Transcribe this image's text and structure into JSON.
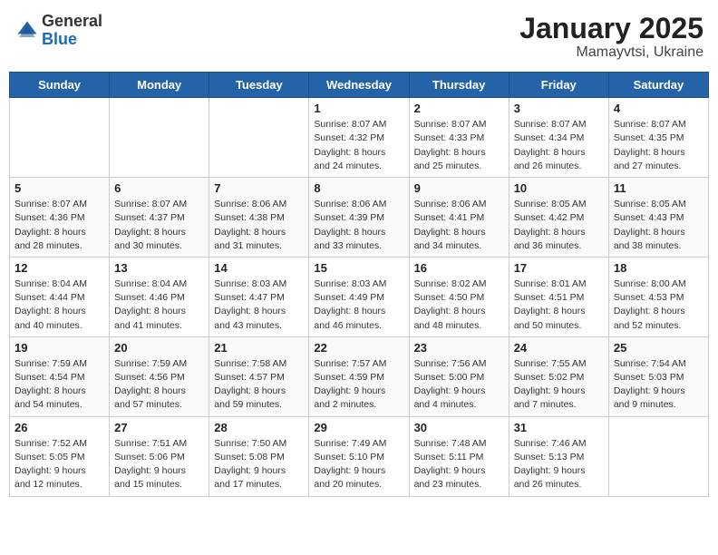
{
  "header": {
    "logo_general": "General",
    "logo_blue": "Blue",
    "title": "January 2025",
    "subtitle": "Mamayvtsi, Ukraine"
  },
  "weekdays": [
    "Sunday",
    "Monday",
    "Tuesday",
    "Wednesday",
    "Thursday",
    "Friday",
    "Saturday"
  ],
  "weeks": [
    [
      {
        "day": "",
        "sunrise": "",
        "sunset": "",
        "daylight": ""
      },
      {
        "day": "",
        "sunrise": "",
        "sunset": "",
        "daylight": ""
      },
      {
        "day": "",
        "sunrise": "",
        "sunset": "",
        "daylight": ""
      },
      {
        "day": "1",
        "sunrise": "Sunrise: 8:07 AM",
        "sunset": "Sunset: 4:32 PM",
        "daylight": "Daylight: 8 hours and 24 minutes."
      },
      {
        "day": "2",
        "sunrise": "Sunrise: 8:07 AM",
        "sunset": "Sunset: 4:33 PM",
        "daylight": "Daylight: 8 hours and 25 minutes."
      },
      {
        "day": "3",
        "sunrise": "Sunrise: 8:07 AM",
        "sunset": "Sunset: 4:34 PM",
        "daylight": "Daylight: 8 hours and 26 minutes."
      },
      {
        "day": "4",
        "sunrise": "Sunrise: 8:07 AM",
        "sunset": "Sunset: 4:35 PM",
        "daylight": "Daylight: 8 hours and 27 minutes."
      }
    ],
    [
      {
        "day": "5",
        "sunrise": "Sunrise: 8:07 AM",
        "sunset": "Sunset: 4:36 PM",
        "daylight": "Daylight: 8 hours and 28 minutes."
      },
      {
        "day": "6",
        "sunrise": "Sunrise: 8:07 AM",
        "sunset": "Sunset: 4:37 PM",
        "daylight": "Daylight: 8 hours and 30 minutes."
      },
      {
        "day": "7",
        "sunrise": "Sunrise: 8:06 AM",
        "sunset": "Sunset: 4:38 PM",
        "daylight": "Daylight: 8 hours and 31 minutes."
      },
      {
        "day": "8",
        "sunrise": "Sunrise: 8:06 AM",
        "sunset": "Sunset: 4:39 PM",
        "daylight": "Daylight: 8 hours and 33 minutes."
      },
      {
        "day": "9",
        "sunrise": "Sunrise: 8:06 AM",
        "sunset": "Sunset: 4:41 PM",
        "daylight": "Daylight: 8 hours and 34 minutes."
      },
      {
        "day": "10",
        "sunrise": "Sunrise: 8:05 AM",
        "sunset": "Sunset: 4:42 PM",
        "daylight": "Daylight: 8 hours and 36 minutes."
      },
      {
        "day": "11",
        "sunrise": "Sunrise: 8:05 AM",
        "sunset": "Sunset: 4:43 PM",
        "daylight": "Daylight: 8 hours and 38 minutes."
      }
    ],
    [
      {
        "day": "12",
        "sunrise": "Sunrise: 8:04 AM",
        "sunset": "Sunset: 4:44 PM",
        "daylight": "Daylight: 8 hours and 40 minutes."
      },
      {
        "day": "13",
        "sunrise": "Sunrise: 8:04 AM",
        "sunset": "Sunset: 4:46 PM",
        "daylight": "Daylight: 8 hours and 41 minutes."
      },
      {
        "day": "14",
        "sunrise": "Sunrise: 8:03 AM",
        "sunset": "Sunset: 4:47 PM",
        "daylight": "Daylight: 8 hours and 43 minutes."
      },
      {
        "day": "15",
        "sunrise": "Sunrise: 8:03 AM",
        "sunset": "Sunset: 4:49 PM",
        "daylight": "Daylight: 8 hours and 46 minutes."
      },
      {
        "day": "16",
        "sunrise": "Sunrise: 8:02 AM",
        "sunset": "Sunset: 4:50 PM",
        "daylight": "Daylight: 8 hours and 48 minutes."
      },
      {
        "day": "17",
        "sunrise": "Sunrise: 8:01 AM",
        "sunset": "Sunset: 4:51 PM",
        "daylight": "Daylight: 8 hours and 50 minutes."
      },
      {
        "day": "18",
        "sunrise": "Sunrise: 8:00 AM",
        "sunset": "Sunset: 4:53 PM",
        "daylight": "Daylight: 8 hours and 52 minutes."
      }
    ],
    [
      {
        "day": "19",
        "sunrise": "Sunrise: 7:59 AM",
        "sunset": "Sunset: 4:54 PM",
        "daylight": "Daylight: 8 hours and 54 minutes."
      },
      {
        "day": "20",
        "sunrise": "Sunrise: 7:59 AM",
        "sunset": "Sunset: 4:56 PM",
        "daylight": "Daylight: 8 hours and 57 minutes."
      },
      {
        "day": "21",
        "sunrise": "Sunrise: 7:58 AM",
        "sunset": "Sunset: 4:57 PM",
        "daylight": "Daylight: 8 hours and 59 minutes."
      },
      {
        "day": "22",
        "sunrise": "Sunrise: 7:57 AM",
        "sunset": "Sunset: 4:59 PM",
        "daylight": "Daylight: 9 hours and 2 minutes."
      },
      {
        "day": "23",
        "sunrise": "Sunrise: 7:56 AM",
        "sunset": "Sunset: 5:00 PM",
        "daylight": "Daylight: 9 hours and 4 minutes."
      },
      {
        "day": "24",
        "sunrise": "Sunrise: 7:55 AM",
        "sunset": "Sunset: 5:02 PM",
        "daylight": "Daylight: 9 hours and 7 minutes."
      },
      {
        "day": "25",
        "sunrise": "Sunrise: 7:54 AM",
        "sunset": "Sunset: 5:03 PM",
        "daylight": "Daylight: 9 hours and 9 minutes."
      }
    ],
    [
      {
        "day": "26",
        "sunrise": "Sunrise: 7:52 AM",
        "sunset": "Sunset: 5:05 PM",
        "daylight": "Daylight: 9 hours and 12 minutes."
      },
      {
        "day": "27",
        "sunrise": "Sunrise: 7:51 AM",
        "sunset": "Sunset: 5:06 PM",
        "daylight": "Daylight: 9 hours and 15 minutes."
      },
      {
        "day": "28",
        "sunrise": "Sunrise: 7:50 AM",
        "sunset": "Sunset: 5:08 PM",
        "daylight": "Daylight: 9 hours and 17 minutes."
      },
      {
        "day": "29",
        "sunrise": "Sunrise: 7:49 AM",
        "sunset": "Sunset: 5:10 PM",
        "daylight": "Daylight: 9 hours and 20 minutes."
      },
      {
        "day": "30",
        "sunrise": "Sunrise: 7:48 AM",
        "sunset": "Sunset: 5:11 PM",
        "daylight": "Daylight: 9 hours and 23 minutes."
      },
      {
        "day": "31",
        "sunrise": "Sunrise: 7:46 AM",
        "sunset": "Sunset: 5:13 PM",
        "daylight": "Daylight: 9 hours and 26 minutes."
      },
      {
        "day": "",
        "sunrise": "",
        "sunset": "",
        "daylight": ""
      }
    ]
  ]
}
